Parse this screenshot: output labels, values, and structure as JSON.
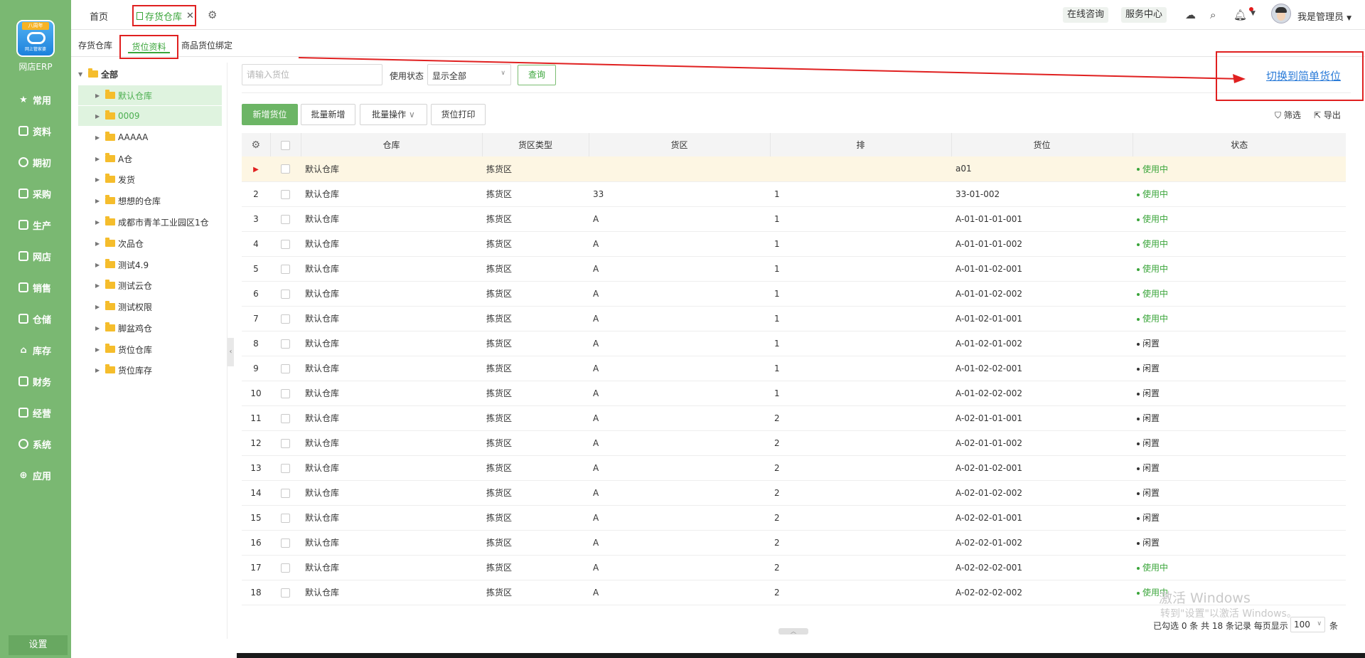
{
  "sidebar": {
    "logo_badge": "八周年",
    "logo_caption": "网上管家婆",
    "app_name": "网店ERP",
    "items": [
      {
        "label": "常用",
        "icon": "star-icon"
      },
      {
        "label": "资料",
        "icon": "document-icon"
      },
      {
        "label": "期初",
        "icon": "clock-icon"
      },
      {
        "label": "采购",
        "icon": "purchase-icon"
      },
      {
        "label": "生产",
        "icon": "production-icon"
      },
      {
        "label": "网店",
        "icon": "shop-icon"
      },
      {
        "label": "销售",
        "icon": "sales-icon"
      },
      {
        "label": "仓储",
        "icon": "warehouse-icon"
      },
      {
        "label": "库存",
        "icon": "home-icon"
      },
      {
        "label": "财务",
        "icon": "finance-icon"
      },
      {
        "label": "经营",
        "icon": "chart-icon"
      },
      {
        "label": "系统",
        "icon": "system-icon"
      },
      {
        "label": "应用",
        "icon": "plus-icon"
      }
    ],
    "settings_label": "设置"
  },
  "topbar": {
    "tabs": [
      {
        "label": "首页"
      },
      {
        "label": "存货仓库",
        "active": true
      }
    ],
    "online_consult": "在线咨询",
    "service_center": "服务中心",
    "user_name": "我是管理员"
  },
  "subtabs": [
    {
      "label": "存货仓库"
    },
    {
      "label": "货位资料",
      "active": true
    },
    {
      "label": "商品货位绑定"
    }
  ],
  "tree": {
    "root": "全部",
    "items": [
      {
        "label": "默认仓库",
        "highlight": true
      },
      {
        "label": "0009",
        "highlight": true
      },
      {
        "label": "AAAAA"
      },
      {
        "label": "A仓"
      },
      {
        "label": "发货"
      },
      {
        "label": "想想的仓库"
      },
      {
        "label": "成都市青羊工业园区1仓"
      },
      {
        "label": "次品仓"
      },
      {
        "label": "测试4.9"
      },
      {
        "label": "测试云仓"
      },
      {
        "label": "测试权限"
      },
      {
        "label": "脚盆鸡仓"
      },
      {
        "label": "货位仓库"
      },
      {
        "label": "货位库存"
      }
    ]
  },
  "filter": {
    "search_placeholder": "请输入货位",
    "status_label": "使用状态",
    "status_value": "显示全部",
    "query_label": "查询",
    "switch_link": "切换到简单货位"
  },
  "actions": {
    "new_location": "新增货位",
    "batch_add": "批量新增",
    "batch_ops": "批量操作",
    "print_location": "货位打印",
    "filter": "筛选",
    "export": "导出"
  },
  "table": {
    "columns": [
      "仓库",
      "货区类型",
      "货区",
      "排",
      "货位",
      "状态"
    ],
    "rows": [
      {
        "idx": "",
        "warehouse": "默认仓库",
        "zone_type": "拣货区",
        "zone": "",
        "row": "",
        "location": "a01",
        "status": "使用中",
        "active": true
      },
      {
        "idx": "2",
        "warehouse": "默认仓库",
        "zone_type": "拣货区",
        "zone": "33",
        "row": "1",
        "location": "33-01-002",
        "status": "使用中",
        "active": true
      },
      {
        "idx": "3",
        "warehouse": "默认仓库",
        "zone_type": "拣货区",
        "zone": "A",
        "row": "1",
        "location": "A-01-01-01-001",
        "status": "使用中",
        "active": true
      },
      {
        "idx": "4",
        "warehouse": "默认仓库",
        "zone_type": "拣货区",
        "zone": "A",
        "row": "1",
        "location": "A-01-01-01-002",
        "status": "使用中",
        "active": true
      },
      {
        "idx": "5",
        "warehouse": "默认仓库",
        "zone_type": "拣货区",
        "zone": "A",
        "row": "1",
        "location": "A-01-01-02-001",
        "status": "使用中",
        "active": true
      },
      {
        "idx": "6",
        "warehouse": "默认仓库",
        "zone_type": "拣货区",
        "zone": "A",
        "row": "1",
        "location": "A-01-01-02-002",
        "status": "使用中",
        "active": true
      },
      {
        "idx": "7",
        "warehouse": "默认仓库",
        "zone_type": "拣货区",
        "zone": "A",
        "row": "1",
        "location": "A-01-02-01-001",
        "status": "使用中",
        "active": true
      },
      {
        "idx": "8",
        "warehouse": "默认仓库",
        "zone_type": "拣货区",
        "zone": "A",
        "row": "1",
        "location": "A-01-02-01-002",
        "status": "闲置",
        "active": false
      },
      {
        "idx": "9",
        "warehouse": "默认仓库",
        "zone_type": "拣货区",
        "zone": "A",
        "row": "1",
        "location": "A-01-02-02-001",
        "status": "闲置",
        "active": false
      },
      {
        "idx": "10",
        "warehouse": "默认仓库",
        "zone_type": "拣货区",
        "zone": "A",
        "row": "1",
        "location": "A-01-02-02-002",
        "status": "闲置",
        "active": false
      },
      {
        "idx": "11",
        "warehouse": "默认仓库",
        "zone_type": "拣货区",
        "zone": "A",
        "row": "2",
        "location": "A-02-01-01-001",
        "status": "闲置",
        "active": false
      },
      {
        "idx": "12",
        "warehouse": "默认仓库",
        "zone_type": "拣货区",
        "zone": "A",
        "row": "2",
        "location": "A-02-01-01-002",
        "status": "闲置",
        "active": false
      },
      {
        "idx": "13",
        "warehouse": "默认仓库",
        "zone_type": "拣货区",
        "zone": "A",
        "row": "2",
        "location": "A-02-01-02-001",
        "status": "闲置",
        "active": false
      },
      {
        "idx": "14",
        "warehouse": "默认仓库",
        "zone_type": "拣货区",
        "zone": "A",
        "row": "2",
        "location": "A-02-01-02-002",
        "status": "闲置",
        "active": false
      },
      {
        "idx": "15",
        "warehouse": "默认仓库",
        "zone_type": "拣货区",
        "zone": "A",
        "row": "2",
        "location": "A-02-02-01-001",
        "status": "闲置",
        "active": false
      },
      {
        "idx": "16",
        "warehouse": "默认仓库",
        "zone_type": "拣货区",
        "zone": "A",
        "row": "2",
        "location": "A-02-02-01-002",
        "status": "闲置",
        "active": false
      },
      {
        "idx": "17",
        "warehouse": "默认仓库",
        "zone_type": "拣货区",
        "zone": "A",
        "row": "2",
        "location": "A-02-02-02-001",
        "status": "使用中",
        "active": true
      },
      {
        "idx": "18",
        "warehouse": "默认仓库",
        "zone_type": "拣货区",
        "zone": "A",
        "row": "2",
        "location": "A-02-02-02-002",
        "status": "使用中",
        "active": true
      }
    ]
  },
  "footer": {
    "summary": "已勾选 0 条 共 18 条记录 每页显示",
    "page_size": "100",
    "unit": "条"
  },
  "watermark": {
    "line1": "激活 Windows",
    "line2": "转到\"设置\"以激活 Windows。"
  },
  "colors": {
    "sidebar_bg": "#7ab872",
    "accent_green": "#3aa53a",
    "annotation_red": "#e02020",
    "link_blue": "#2a7bd8"
  }
}
